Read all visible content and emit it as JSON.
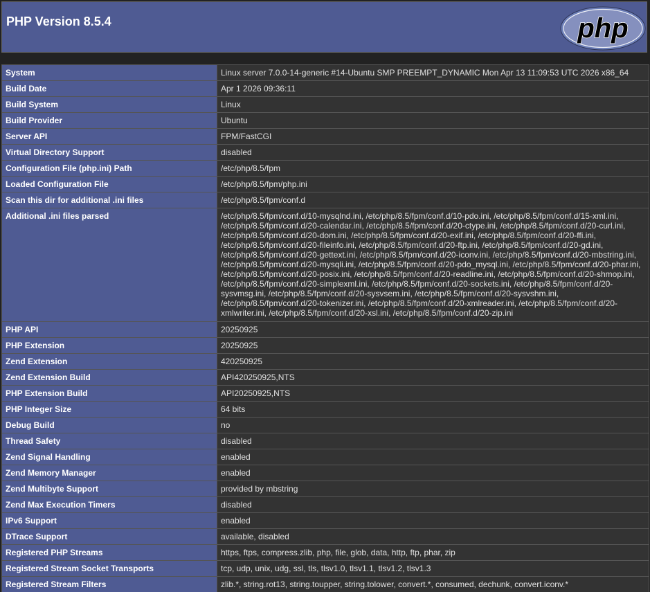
{
  "header": {
    "title": "PHP Version 8.5.4",
    "logo_text": "php"
  },
  "colors": {
    "header_bg": "#4f5b93",
    "label_bg": "#4f5b93",
    "value_bg": "#333333",
    "page_bg": "#222222"
  },
  "rows": [
    {
      "label": "System",
      "value": "Linux server 7.0.0-14-generic #14-Ubuntu SMP PREEMPT_DYNAMIC Mon Apr 13 11:09:53 UTC 2026 x86_64"
    },
    {
      "label": "Build Date",
      "value": "Apr 1 2026 09:36:11"
    },
    {
      "label": "Build System",
      "value": "Linux"
    },
    {
      "label": "Build Provider",
      "value": "Ubuntu"
    },
    {
      "label": "Server API",
      "value": "FPM/FastCGI"
    },
    {
      "label": "Virtual Directory Support",
      "value": "disabled"
    },
    {
      "label": "Configuration File (php.ini) Path",
      "value": "/etc/php/8.5/fpm"
    },
    {
      "label": "Loaded Configuration File",
      "value": "/etc/php/8.5/fpm/php.ini"
    },
    {
      "label": "Scan this dir for additional .ini files",
      "value": "/etc/php/8.5/fpm/conf.d"
    },
    {
      "label": "Additional .ini files parsed",
      "value": "/etc/php/8.5/fpm/conf.d/10-mysqlnd.ini, /etc/php/8.5/fpm/conf.d/10-pdo.ini, /etc/php/8.5/fpm/conf.d/15-xml.ini, /etc/php/8.5/fpm/conf.d/20-calendar.ini, /etc/php/8.5/fpm/conf.d/20-ctype.ini, /etc/php/8.5/fpm/conf.d/20-curl.ini, /etc/php/8.5/fpm/conf.d/20-dom.ini, /etc/php/8.5/fpm/conf.d/20-exif.ini, /etc/php/8.5/fpm/conf.d/20-ffi.ini, /etc/php/8.5/fpm/conf.d/20-fileinfo.ini, /etc/php/8.5/fpm/conf.d/20-ftp.ini, /etc/php/8.5/fpm/conf.d/20-gd.ini, /etc/php/8.5/fpm/conf.d/20-gettext.ini, /etc/php/8.5/fpm/conf.d/20-iconv.ini, /etc/php/8.5/fpm/conf.d/20-mbstring.ini, /etc/php/8.5/fpm/conf.d/20-mysqli.ini, /etc/php/8.5/fpm/conf.d/20-pdo_mysql.ini, /etc/php/8.5/fpm/conf.d/20-phar.ini, /etc/php/8.5/fpm/conf.d/20-posix.ini, /etc/php/8.5/fpm/conf.d/20-readline.ini, /etc/php/8.5/fpm/conf.d/20-shmop.ini, /etc/php/8.5/fpm/conf.d/20-simplexml.ini, /etc/php/8.5/fpm/conf.d/20-sockets.ini, /etc/php/8.5/fpm/conf.d/20-sysvmsg.ini, /etc/php/8.5/fpm/conf.d/20-sysvsem.ini, /etc/php/8.5/fpm/conf.d/20-sysvshm.ini, /etc/php/8.5/fpm/conf.d/20-tokenizer.ini, /etc/php/8.5/fpm/conf.d/20-xmlreader.ini, /etc/php/8.5/fpm/conf.d/20-xmlwriter.ini, /etc/php/8.5/fpm/conf.d/20-xsl.ini, /etc/php/8.5/fpm/conf.d/20-zip.ini"
    },
    {
      "label": "PHP API",
      "value": "20250925"
    },
    {
      "label": "PHP Extension",
      "value": "20250925"
    },
    {
      "label": "Zend Extension",
      "value": "420250925"
    },
    {
      "label": "Zend Extension Build",
      "value": "API420250925,NTS"
    },
    {
      "label": "PHP Extension Build",
      "value": "API20250925,NTS"
    },
    {
      "label": "PHP Integer Size",
      "value": "64 bits"
    },
    {
      "label": "Debug Build",
      "value": "no"
    },
    {
      "label": "Thread Safety",
      "value": "disabled"
    },
    {
      "label": "Zend Signal Handling",
      "value": "enabled"
    },
    {
      "label": "Zend Memory Manager",
      "value": "enabled"
    },
    {
      "label": "Zend Multibyte Support",
      "value": "provided by mbstring"
    },
    {
      "label": "Zend Max Execution Timers",
      "value": "disabled"
    },
    {
      "label": "IPv6 Support",
      "value": "enabled"
    },
    {
      "label": "DTrace Support",
      "value": "available, disabled"
    },
    {
      "label": "Registered PHP Streams",
      "value": "https, ftps, compress.zlib, php, file, glob, data, http, ftp, phar, zip"
    },
    {
      "label": "Registered Stream Socket Transports",
      "value": "tcp, udp, unix, udg, ssl, tls, tlsv1.0, tlsv1.1, tlsv1.2, tlsv1.3"
    },
    {
      "label": "Registered Stream Filters",
      "value": "zlib.*, string.rot13, string.toupper, string.tolower, convert.*, consumed, dechunk, convert.iconv.*"
    }
  ]
}
